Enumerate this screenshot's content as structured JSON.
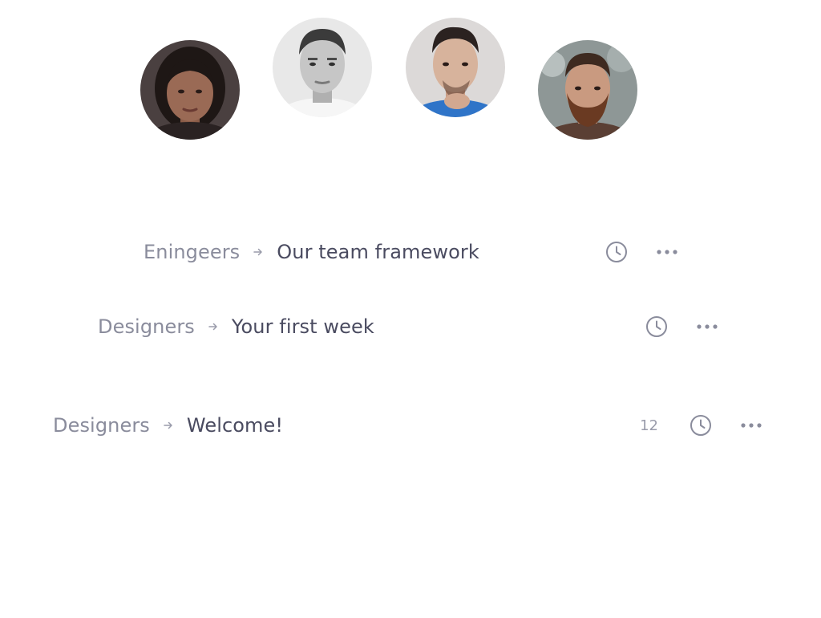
{
  "avatars": [
    {
      "name": "avatar-1",
      "bg": "#3a3030",
      "skin": "#9a6a55",
      "hair": "#1e1715",
      "shirt": "#2a2222"
    },
    {
      "name": "avatar-2",
      "bg": "#e6e6e6",
      "skin": "#c9c9c9",
      "hair": "#3b3b3b",
      "shirt": "#f4f4f4"
    },
    {
      "name": "avatar-3",
      "bg": "#d9d6d5",
      "skin": "#d7b39c",
      "hair": "#2b2220",
      "shirt": "#2f74c8"
    },
    {
      "name": "avatar-4",
      "bg": "#8c9594",
      "skin": "#c99a80",
      "hair": "#3e2a20",
      "shirt": "#5a3f34"
    }
  ],
  "rows": [
    {
      "parent": "Eningeers",
      "page": "Our team framework",
      "count": ""
    },
    {
      "parent": "Designers",
      "page": "Your first week",
      "count": ""
    },
    {
      "parent": "Designers",
      "page": "Welcome!",
      "count": "12"
    }
  ],
  "icons": {
    "separator": "arrow-right-icon",
    "history": "clock-icon",
    "more": "more-horizontal-icon"
  },
  "colors": {
    "parent_text": "#8a8c9c",
    "page_text": "#4a4b60",
    "icon": "#8a8c9c"
  }
}
